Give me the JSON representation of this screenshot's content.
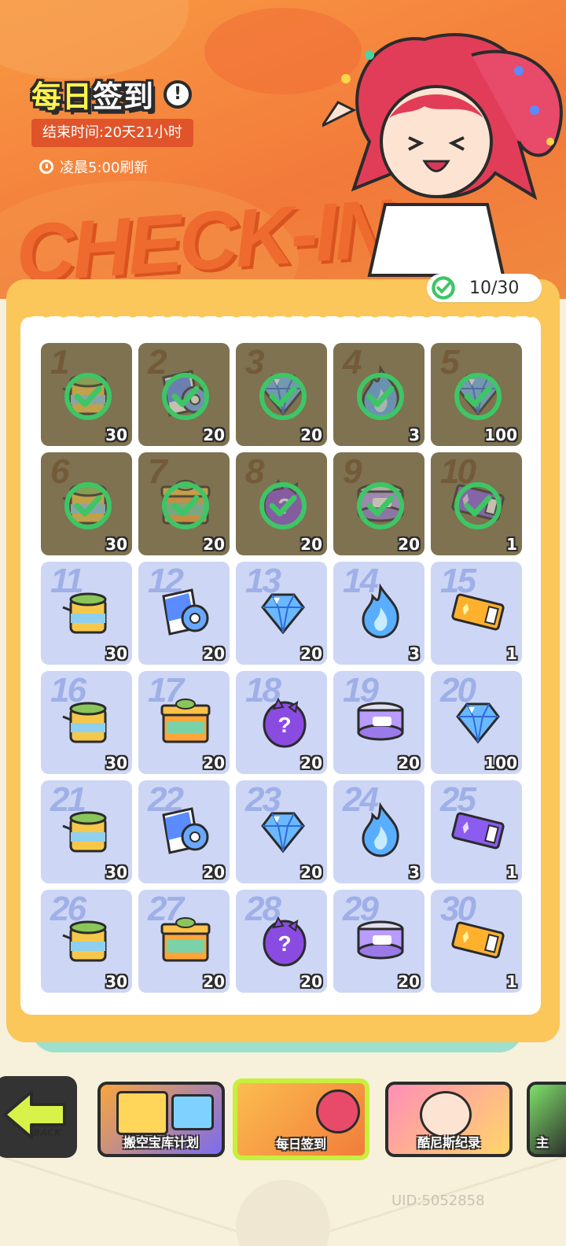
{
  "header": {
    "title_part1": "每日",
    "title_part2": "签到",
    "info_icon": "exclamation-icon",
    "end_time": "结束时间:20天21小时",
    "refresh_text": "凌晨5:00刷新",
    "banner_word": "CHECK-IN"
  },
  "progress": {
    "text": "10/30",
    "done": 10,
    "total": 30
  },
  "days": [
    {
      "day": "1",
      "qty": "30",
      "item": "jar",
      "done": true
    },
    {
      "day": "2",
      "qty": "20",
      "item": "tape",
      "done": true
    },
    {
      "day": "3",
      "qty": "20",
      "item": "gem",
      "done": true
    },
    {
      "day": "4",
      "qty": "3",
      "item": "flame",
      "done": true
    },
    {
      "day": "5",
      "qty": "100",
      "item": "gem",
      "done": true
    },
    {
      "day": "6",
      "qty": "30",
      "item": "jar",
      "done": true
    },
    {
      "day": "7",
      "qty": "20",
      "item": "box",
      "done": true
    },
    {
      "day": "8",
      "qty": "20",
      "item": "egg",
      "done": true
    },
    {
      "day": "9",
      "qty": "20",
      "item": "can",
      "done": true
    },
    {
      "day": "10",
      "qty": "1",
      "item": "ticket-purple",
      "done": true
    },
    {
      "day": "11",
      "qty": "30",
      "item": "jar",
      "done": false
    },
    {
      "day": "12",
      "qty": "20",
      "item": "tape",
      "done": false
    },
    {
      "day": "13",
      "qty": "20",
      "item": "gem",
      "done": false
    },
    {
      "day": "14",
      "qty": "3",
      "item": "flame",
      "done": false
    },
    {
      "day": "15",
      "qty": "1",
      "item": "ticket-gold",
      "done": false
    },
    {
      "day": "16",
      "qty": "30",
      "item": "jar",
      "done": false
    },
    {
      "day": "17",
      "qty": "20",
      "item": "box",
      "done": false
    },
    {
      "day": "18",
      "qty": "20",
      "item": "egg",
      "done": false
    },
    {
      "day": "19",
      "qty": "20",
      "item": "can",
      "done": false
    },
    {
      "day": "20",
      "qty": "100",
      "item": "gem",
      "done": false
    },
    {
      "day": "21",
      "qty": "30",
      "item": "jar",
      "done": false
    },
    {
      "day": "22",
      "qty": "20",
      "item": "tape",
      "done": false
    },
    {
      "day": "23",
      "qty": "20",
      "item": "gem",
      "done": false
    },
    {
      "day": "24",
      "qty": "3",
      "item": "flame",
      "done": false
    },
    {
      "day": "25",
      "qty": "1",
      "item": "ticket-purple",
      "done": false
    },
    {
      "day": "26",
      "qty": "30",
      "item": "jar",
      "done": false
    },
    {
      "day": "27",
      "qty": "20",
      "item": "box",
      "done": false
    },
    {
      "day": "28",
      "qty": "20",
      "item": "egg",
      "done": false
    },
    {
      "day": "29",
      "qty": "20",
      "item": "can",
      "done": false
    },
    {
      "day": "30",
      "qty": "1",
      "item": "ticket-gold",
      "done": false
    }
  ],
  "nav": {
    "back_label": "BACK",
    "items": [
      "搬空宝库计划",
      "每日签到",
      "酷尼斯纪录",
      "主"
    ]
  },
  "uid": "UID:5052858",
  "colors": {
    "banner": "#f2793a",
    "card_border": "#fbc65a",
    "cell_pending": "#cdd6f5",
    "cell_done": "#7e7250",
    "check_green": "#3ec565"
  }
}
